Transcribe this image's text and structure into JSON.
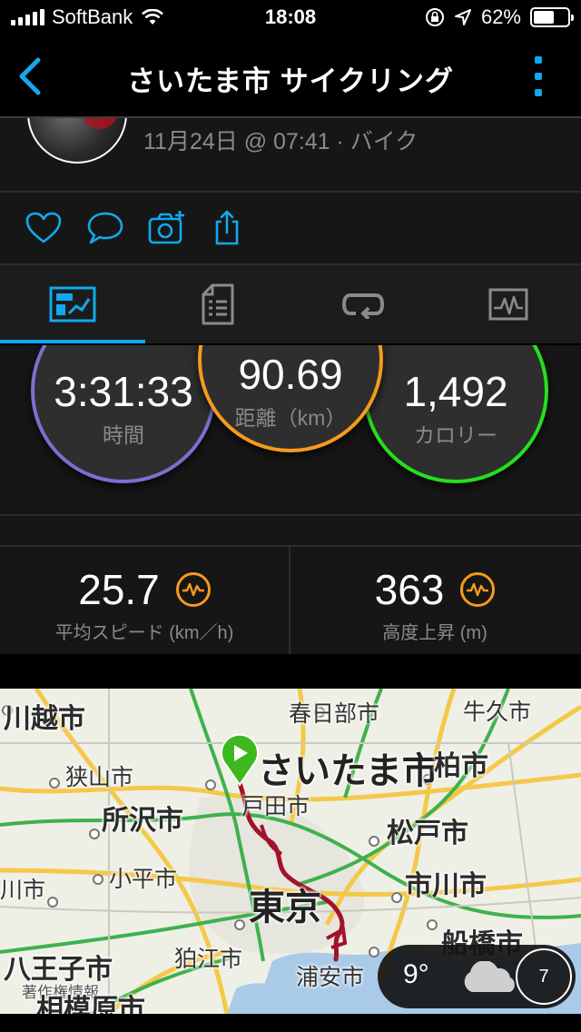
{
  "status_bar": {
    "carrier": "SoftBank",
    "time": "18:08",
    "battery_percent": "62%",
    "battery_level": 0.62
  },
  "nav": {
    "title": "さいたま市 サイクリング"
  },
  "activity": {
    "meta": "11月24日 @ 07:41 · バイク"
  },
  "actions": {
    "icons": [
      "heart-icon",
      "comment-icon",
      "add-photo-icon",
      "share-icon"
    ]
  },
  "tabs": {
    "icons": [
      "summary-icon",
      "details-icon",
      "laps-icon",
      "chart-icon"
    ],
    "active_index": 0
  },
  "rings": {
    "time": {
      "value": "3:31:33",
      "label": "時間",
      "color": "#7b6fd0"
    },
    "distance": {
      "value": "90.69",
      "label": "距離（km）",
      "color": "#f59b1c"
    },
    "calories": {
      "value": "1,492",
      "label": "カロリー",
      "color": "#24e01c"
    }
  },
  "stats": {
    "avg_speed": {
      "value": "25.7",
      "label": "平均スピード (km／h)"
    },
    "elevation_gain": {
      "value": "363",
      "label": "高度上昇 (m)"
    }
  },
  "map": {
    "labels": {
      "kawagoe": "川越市",
      "kasukabe": "春日部市",
      "ushiku": "牛久市",
      "saitama": "さいたま市",
      "sayama": "狭山市",
      "kashiwa": "柏市",
      "toda": "戸田市",
      "tokorozawa": "所沢市",
      "matsudo": "松戸市",
      "kodaira": "小平市",
      "ichikawa": "市川市",
      "kawaichi": "川市",
      "tokyo": "東京",
      "funabashi": "船橋市",
      "komae": "狛江市",
      "hachioji": "八王子市",
      "urayasu": "浦安市",
      "copyright": "著作権情報",
      "sagamihara": "相模原市"
    }
  },
  "weather": {
    "temperature": "9°",
    "icon": "cloud-icon",
    "wind": "7"
  },
  "colors": {
    "accent": "#11a9ed",
    "route": "#a3122a",
    "start_marker": "#3db81e"
  }
}
